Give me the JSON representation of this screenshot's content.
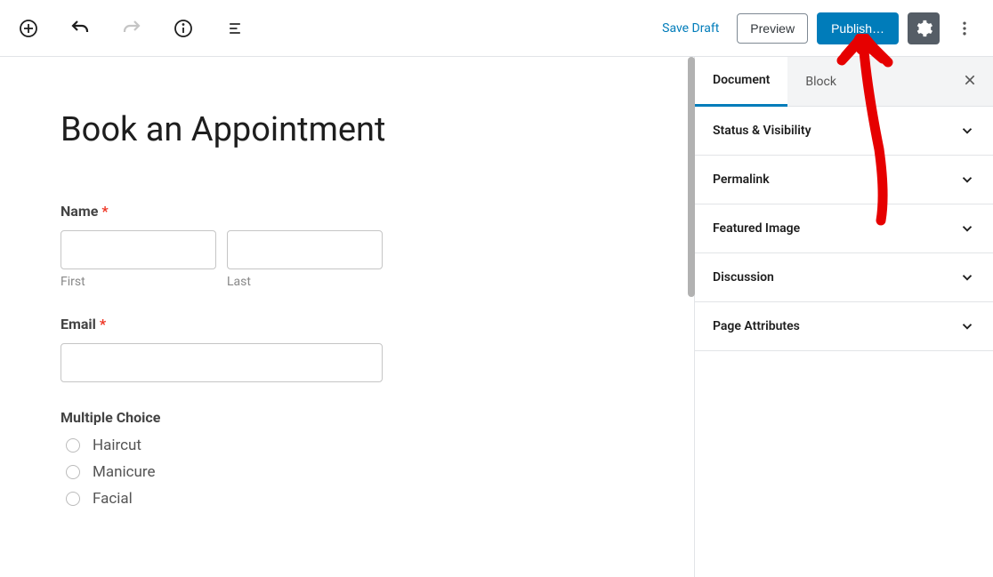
{
  "toolbar": {
    "save_draft": "Save Draft",
    "preview": "Preview",
    "publish": "Publish…"
  },
  "editor": {
    "page_title": "Book an Appointment",
    "form": {
      "name_label": "Name",
      "first_sub": "First",
      "last_sub": "Last",
      "email_label": "Email",
      "choice_label": "Multiple Choice",
      "choices": [
        "Haircut",
        "Manicure",
        "Facial"
      ]
    }
  },
  "sidebar": {
    "tabs": {
      "document": "Document",
      "block": "Block"
    },
    "panels": [
      "Status & Visibility",
      "Permalink",
      "Featured Image",
      "Discussion",
      "Page Attributes"
    ]
  }
}
